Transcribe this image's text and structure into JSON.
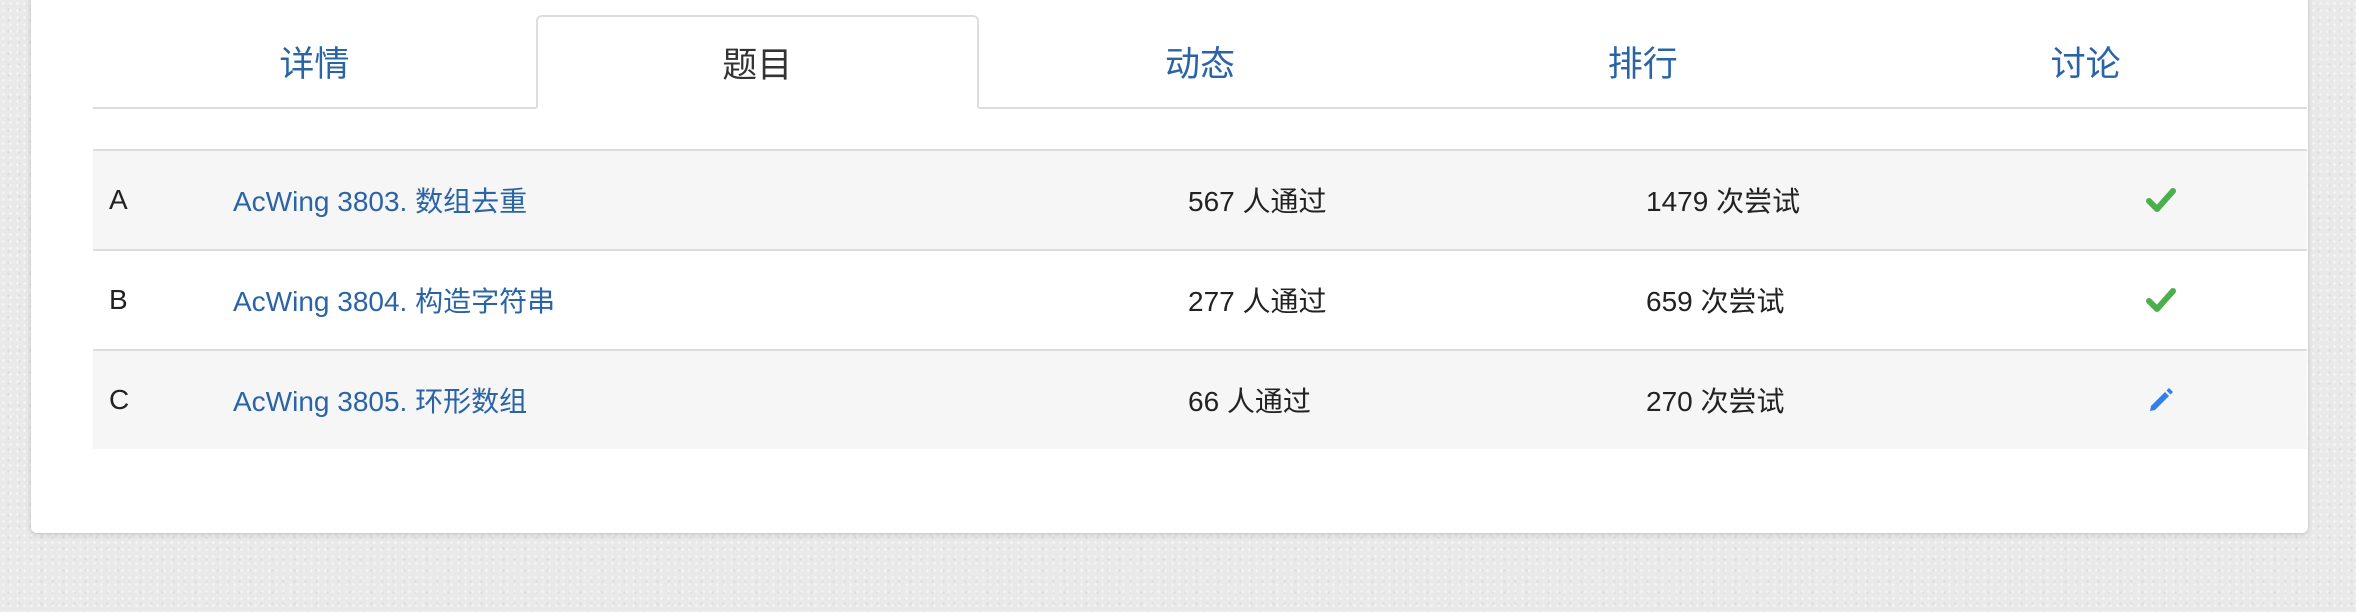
{
  "tabs": [
    {
      "label": "详情",
      "active": false
    },
    {
      "label": "题目",
      "active": true
    },
    {
      "label": "动态",
      "active": false
    },
    {
      "label": "排行",
      "active": false
    },
    {
      "label": "讨论",
      "active": false
    }
  ],
  "problems": [
    {
      "letter": "A",
      "title": "AcWing 3803. 数组去重",
      "passed": "567 人通过",
      "attempts": "1479 次尝试",
      "status_icon": "checkmark-icon"
    },
    {
      "letter": "B",
      "title": "AcWing 3804. 构造字符串",
      "passed": "277 人通过",
      "attempts": "659 次尝试",
      "status_icon": "checkmark-icon"
    },
    {
      "letter": "C",
      "title": "AcWing 3805. 环形数组",
      "passed": "66 人通过",
      "attempts": "270 次尝试",
      "status_icon": "pencil-icon"
    }
  ],
  "colors": {
    "link": "#2a64a6",
    "check": "#4cae4c",
    "pencil": "#2f80ed",
    "stripe": "#f6f6f6"
  }
}
